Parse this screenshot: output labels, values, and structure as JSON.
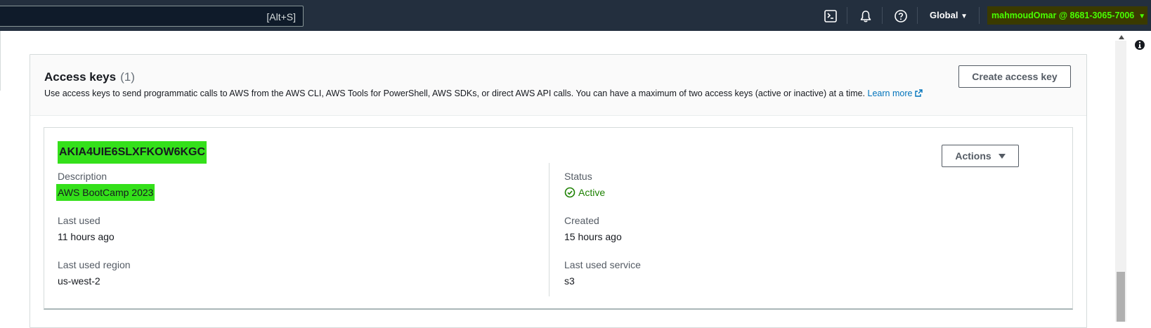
{
  "topbar": {
    "search_shortcut": "[Alt+S]",
    "icons": [
      "cloudshell-icon",
      "bell-icon",
      "help-icon"
    ],
    "region": "Global",
    "account": "mahmoudOmar @ 8681-3065-7006"
  },
  "access_keys": {
    "title": "Access keys",
    "count": "(1)",
    "description": "Use access keys to send programmatic calls to AWS from the AWS CLI, AWS Tools for PowerShell, AWS SDKs, or direct AWS API calls. You can have a maximum of two access keys (active or inactive) at a time.",
    "learn_more": "Learn more",
    "create_button": "Create access key"
  },
  "key": {
    "id": "AKIA4UIE6SLXFKOW6KGC",
    "actions_button": "Actions",
    "description_label": "Description",
    "description_value": "AWS BootCamp 2023",
    "status_label": "Status",
    "status_value": "Active",
    "last_used_label": "Last used",
    "last_used_value": "11 hours ago",
    "created_label": "Created",
    "created_value": "15 hours ago",
    "last_used_region_label": "Last used region",
    "last_used_region_value": "us-west-2",
    "last_used_service_label": "Last used service",
    "last_used_service_value": "s3"
  },
  "colors": {
    "topbar_bg": "#232f3e",
    "highlight": "#34e01a",
    "account_text": "#49ff00",
    "active_status": "#1d8102",
    "link": "#0073bb"
  }
}
